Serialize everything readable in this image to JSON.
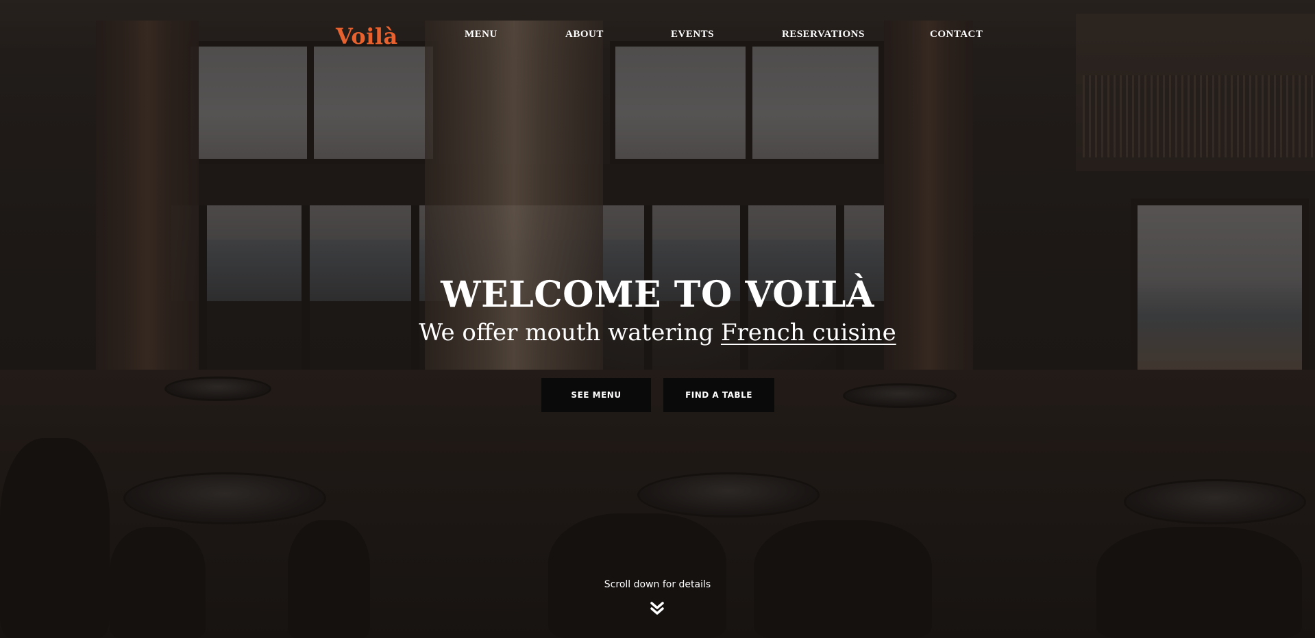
{
  "brand": {
    "logo": "Voilà",
    "accent_color": "#e8622f"
  },
  "nav": {
    "items": [
      {
        "label": "MENU"
      },
      {
        "label": "ABOUT"
      },
      {
        "label": "EVENTS"
      },
      {
        "label": "RESERVATIONS"
      },
      {
        "label": "CONTACT"
      }
    ]
  },
  "hero": {
    "title": "WELCOME TO VOILÀ",
    "subtitle_prefix": "We offer mouth watering ",
    "subtitle_highlight": "French cuisine",
    "buttons": {
      "see_menu": "SEE MENU",
      "find_table": "FIND A TABLE"
    },
    "scroll_hint": "Scroll down for details",
    "scroll_icon": "double-chevron-down-icon"
  }
}
